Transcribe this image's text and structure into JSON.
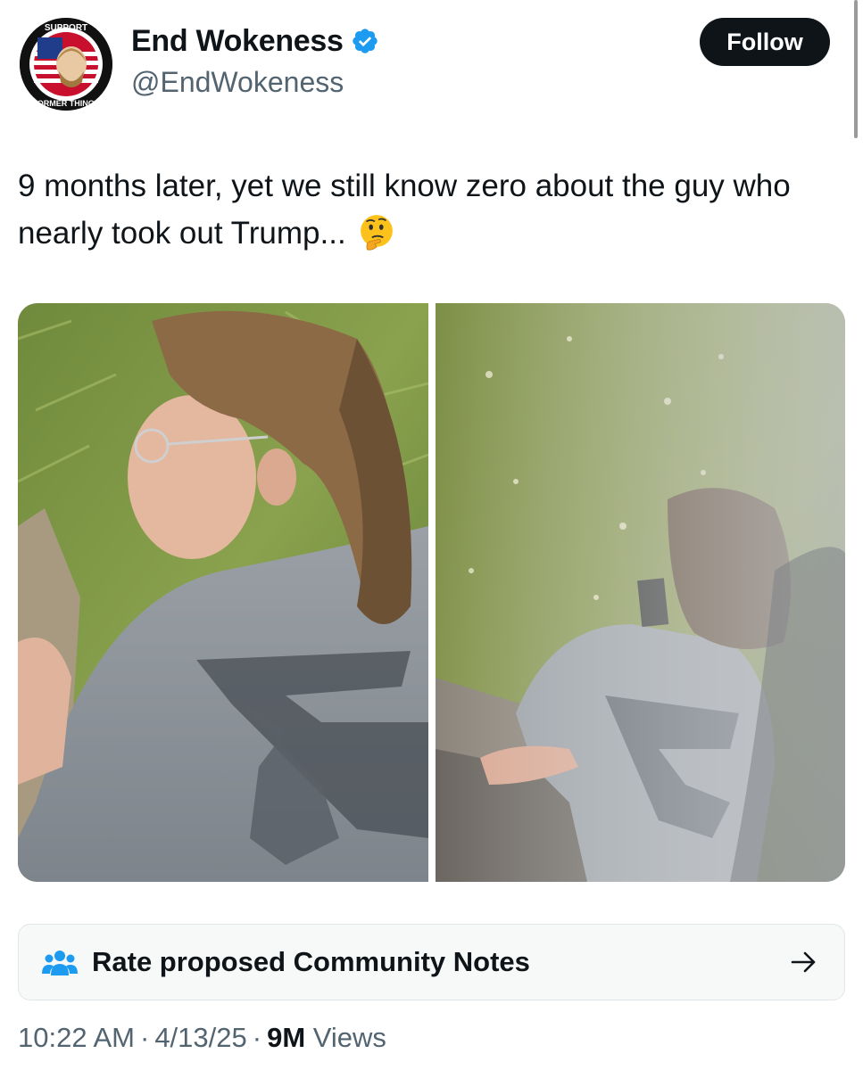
{
  "author": {
    "display_name": "End Wokeness",
    "handle": "@EndWokeness",
    "verified": true,
    "avatar": {
      "top_text": "I SUPPORT THE",
      "bottom_text": "FORMER THING"
    }
  },
  "follow_button": {
    "label": "Follow"
  },
  "tweet": {
    "text": "9 months later, yet we still know zero about the guy who nearly took out Trump...",
    "emoji": "thinking-face"
  },
  "media": {
    "photo_count": 2,
    "description_left": "young man with glasses and long hair, gray t-shirt, grass background",
    "description_right": "person from behind, gray t-shirt with eagle logo, grass background"
  },
  "community_notes": {
    "label": "Rate proposed Community Notes",
    "icon": "people-icon",
    "arrow": "arrow-right-icon"
  },
  "meta": {
    "time": "10:22 AM",
    "date": "4/13/25",
    "separator": "·",
    "views_count": "9M",
    "views_label": "Views"
  },
  "colors": {
    "text_primary": "#0f1419",
    "text_secondary": "#536471",
    "verified_blue": "#1d9bf0",
    "follow_bg": "#0f1419"
  }
}
